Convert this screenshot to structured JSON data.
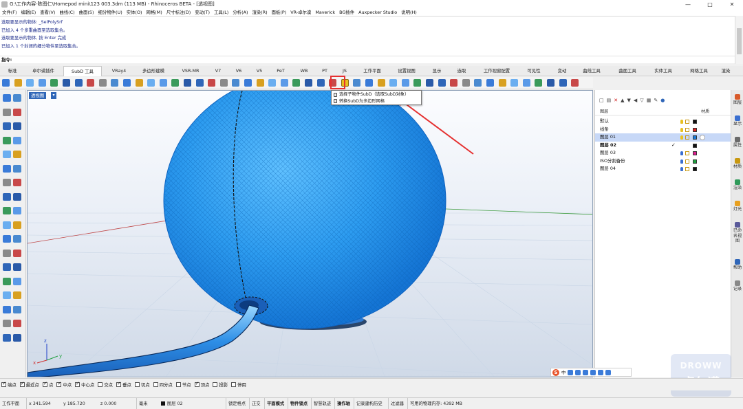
{
  "window": {
    "title": "G:\\工作内容-陈图仁\\Homepod mini\\123 003.3dm (113 MB) - Rhinoceros BETA - [透视图]",
    "controls": [
      "—",
      "□",
      "✕"
    ]
  },
  "menu": [
    "文件(F)",
    "编辑(E)",
    "查看(V)",
    "曲线(C)",
    "曲面(S)",
    "细分物件(U)",
    "实体(O)",
    "网格(M)",
    "尺寸标注(D)",
    "变动(T)",
    "工具(L)",
    "分析(A)",
    "渲染(R)",
    "面板(P)",
    "VR-卓尔谟",
    "Maverick",
    "BG插件",
    "Auxpecker Studio",
    "说明(H)"
  ],
  "command_history": [
    "选取要显示的物体: _SelPolySrf",
    "已加入 4 个多重曲面至选取集合。",
    "选取要显示的物体, 按 Enter 完成",
    "已加入 1 个封闭的细分物件至选取集合。"
  ],
  "command_prompt": "指令:",
  "tabs": [
    {
      "label": "标准",
      "active": false
    },
    {
      "label": "卓尔谟插件",
      "active": false
    },
    {
      "label": "SubD 工具",
      "active": true
    },
    {
      "label": "VRay4",
      "active": false
    },
    {
      "label": "多边形建模",
      "active": false
    },
    {
      "label": "VSR-MR",
      "active": false
    },
    {
      "label": "V7",
      "active": false
    },
    {
      "label": "V6",
      "active": false
    },
    {
      "label": "V5",
      "active": false
    },
    {
      "label": "PeT",
      "active": false
    },
    {
      "label": "WB",
      "active": false
    },
    {
      "label": "PT",
      "active": false
    },
    {
      "label": "JS",
      "active": false
    },
    {
      "label": "工作平面",
      "active": false
    },
    {
      "label": "设置视图",
      "active": false
    },
    {
      "label": "显示",
      "active": false
    },
    {
      "label": "选取",
      "active": false
    },
    {
      "label": "工作视窗配置",
      "active": false
    },
    {
      "label": "可见性",
      "active": false
    },
    {
      "label": "变动",
      "active": false
    },
    {
      "label": "曲线工具",
      "active": false
    },
    {
      "label": "曲面工具",
      "active": false
    },
    {
      "label": "实体工具",
      "active": false
    },
    {
      "label": "网格工具",
      "active": false
    },
    {
      "label": "渲染",
      "active": false
    }
  ],
  "viewport": {
    "label": "透视图",
    "axis_labels": {
      "x": "x",
      "y": "y",
      "z": "z"
    }
  },
  "popup": {
    "item1": "选择子物件SubD（选取SubD对象）",
    "item2": "转换SubD为多边形网格"
  },
  "layers": {
    "header_name": "图层",
    "header_material": "材质",
    "rows": [
      {
        "name": "默认",
        "color": "#111111",
        "bulb": "#e8c020",
        "current": false,
        "selected": false
      },
      {
        "name": "线条",
        "color": "#e02020",
        "bulb": "#e8c020",
        "current": false,
        "selected": false
      },
      {
        "name": "图层 01",
        "color": "#1a7ad8",
        "bulb": "#e8c020",
        "current": false,
        "selected": true
      },
      {
        "name": "图层 02",
        "color": "#111111",
        "bulb": "",
        "current": true,
        "selected": false
      },
      {
        "name": "图层 03",
        "color": "#e02090",
        "bulb": "#3a6fd0",
        "current": false,
        "selected": false
      },
      {
        "name": "ISO分割备份",
        "color": "#20a040",
        "bulb": "#3a6fd0",
        "current": false,
        "selected": false
      },
      {
        "name": "图层 04",
        "color": "#111111",
        "bulb": "#3a6fd0",
        "current": false,
        "selected": false
      }
    ]
  },
  "side_tabs": [
    "图层",
    "显示",
    "属性",
    "材质",
    "渲染",
    "灯光",
    "已命名视图",
    "帮助",
    "记录"
  ],
  "osnaps": [
    {
      "label": "端点",
      "on": true
    },
    {
      "label": "最近点",
      "on": true
    },
    {
      "label": "点",
      "on": true
    },
    {
      "label": "中点",
      "on": true
    },
    {
      "label": "中心点",
      "on": true
    },
    {
      "label": "交点",
      "on": false
    },
    {
      "label": "垂点",
      "on": true
    },
    {
      "label": "切点",
      "on": false
    },
    {
      "label": "四分点",
      "on": false
    },
    {
      "label": "节点",
      "on": false
    },
    {
      "label": "顶点",
      "on": true
    },
    {
      "label": "投影",
      "on": false
    },
    {
      "label": "停用",
      "on": false
    }
  ],
  "statusbar": {
    "cplane": "工作平面",
    "x": "x 341.594",
    "y": "y 185.720",
    "z": "z 0.000",
    "units": "毫米",
    "layer": "图层 02",
    "grid_snap": "锁定格点",
    "ortho": "正交",
    "planar": "平面模式",
    "osnap": "物件锁点",
    "smarttrack": "智慧轨迹",
    "gumball": "操作轴",
    "history": "记录建构历史",
    "filter": "过滤器",
    "memory": "可用的物理内存: 4392 MB"
  },
  "ime": {
    "logo": "S",
    "text": "中"
  },
  "watermark": {
    "line1": "DROWW",
    "line2": "卓尔谟"
  },
  "colors": {
    "sphere": "#2d9cf0",
    "highlight": "#e53030",
    "grid": "#c9d6e6",
    "accent": "#2f66b8"
  }
}
